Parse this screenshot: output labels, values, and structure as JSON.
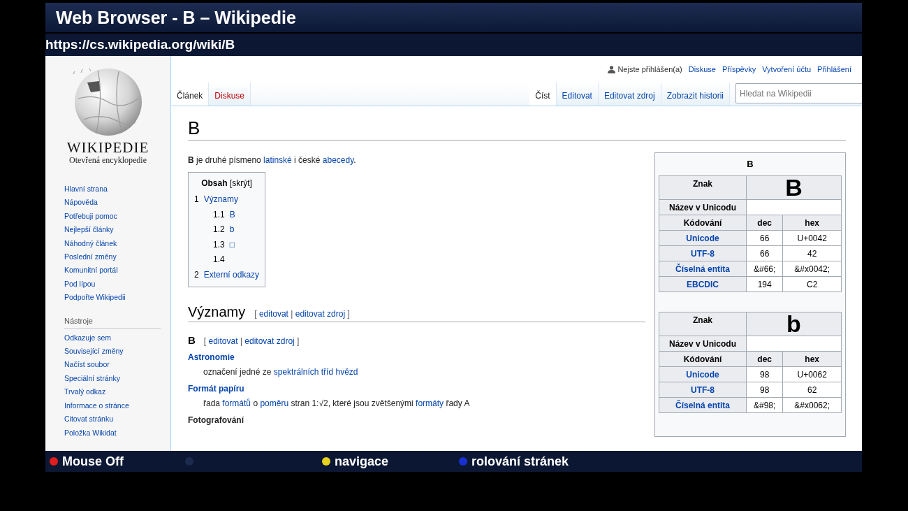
{
  "window": {
    "title": "Web Browser - B – Wikipedie"
  },
  "address_bar": {
    "url": "https://cs.wikipedia.org/wiki/B"
  },
  "page": {
    "logo": {
      "wordmark": "WIKIPEDIE",
      "tagline": "Otevřená encyklopedie"
    },
    "sidebar": {
      "navigation": [
        "Hlavní strana",
        "Nápověda",
        "Potřebuji pomoc",
        "Nejlepší články",
        "Náhodný článek",
        "Poslední změny",
        "Komunitní portál",
        "Pod lípou",
        "Podpořte Wikipedii"
      ],
      "tools_heading": "Nástroje",
      "tools": [
        "Odkazuje sem",
        "Související změny",
        "Načíst soubor",
        "Speciální stránky",
        "Trvalý odkaz",
        "Informace o stránce",
        "Citovat stránku",
        "Položka Wikidat"
      ]
    },
    "user_bar": {
      "status": "Nejste přihlášen(a)",
      "links": [
        "Diskuse",
        "Příspěvky",
        "Vytvoření účtu",
        "Přihlášení"
      ]
    },
    "tabs_left": [
      {
        "label": "Článek",
        "selected": true,
        "red_link": false
      },
      {
        "label": "Diskuse",
        "selected": false,
        "red_link": true
      }
    ],
    "tabs_right": [
      {
        "label": "Číst",
        "selected": true
      },
      {
        "label": "Editovat",
        "selected": false
      },
      {
        "label": "Editovat zdroj",
        "selected": false
      },
      {
        "label": "Zobrazit historii",
        "selected": false
      }
    ],
    "search": {
      "placeholder": "Hledat na Wikipedii"
    },
    "heading": "B",
    "intro": [
      {
        "kind": "bold",
        "text": "B"
      },
      {
        "kind": "text",
        "text": " je druhé písmeno "
      },
      {
        "kind": "link",
        "text": "latinské"
      },
      {
        "kind": "text",
        "text": " i české "
      },
      {
        "kind": "link",
        "text": "abecedy"
      },
      {
        "kind": "text",
        "text": "."
      }
    ],
    "toc": {
      "title": "Obsah",
      "toggle": "[skrýt]",
      "items": [
        {
          "number": "1",
          "label": "Významy",
          "children": [
            {
              "number": "1.1",
              "label": "B"
            },
            {
              "number": "1.2",
              "label": "b"
            },
            {
              "number": "1.3",
              "label": "□"
            },
            {
              "number": "1.4"
            }
          ]
        },
        {
          "number": "2",
          "label": "Externí odkazy"
        }
      ]
    },
    "section": {
      "title": "Významy",
      "edit_links": [
        {
          "kind": "text",
          "text": "[ "
        },
        {
          "kind": "link",
          "text": "editovat"
        },
        {
          "kind": "text",
          "text": " | "
        },
        {
          "kind": "link",
          "text": "editovat zdroj"
        },
        {
          "kind": "text",
          "text": " ]"
        }
      ]
    },
    "subsection": {
      "title": "B",
      "edit_links": [
        {
          "kind": "text",
          "text": "[ "
        },
        {
          "kind": "link",
          "text": "editovat"
        },
        {
          "kind": "text",
          "text": " | "
        },
        {
          "kind": "link",
          "text": "editovat zdroj"
        },
        {
          "kind": "text",
          "text": " ]"
        }
      ]
    },
    "definitions": [
      {
        "term": "Astronomie",
        "term_is_link": true,
        "description": [
          {
            "kind": "text",
            "text": "označení jedné ze "
          },
          {
            "kind": "link",
            "text": "spektrálních tříd hvězd"
          }
        ]
      },
      {
        "term": "Formát papíru",
        "term_is_link": true,
        "description": [
          {
            "kind": "text",
            "text": "řada "
          },
          {
            "kind": "link",
            "text": "formátů"
          },
          {
            "kind": "text",
            "text": " o "
          },
          {
            "kind": "link",
            "text": "poměru"
          },
          {
            "kind": "text",
            "text": " stran 1:√2, které jsou zvětšenými "
          },
          {
            "kind": "link",
            "text": "formáty"
          },
          {
            "kind": "text",
            "text": " řady A"
          }
        ]
      },
      {
        "term": "Fotografování",
        "term_is_link": false
      }
    ],
    "infobox": {
      "title": "B",
      "tables": [
        {
          "glyph_label": "Znak",
          "glyph": "B",
          "name_label": "Název v Unicodu",
          "columns": [
            "Kódování",
            "dec",
            "hex"
          ],
          "rows": [
            {
              "label": "Unicode",
              "dec": "66",
              "hex": "U+0042"
            },
            {
              "label": "UTF-8",
              "dec": "66",
              "hex": "42"
            },
            {
              "label": "Číselná entita",
              "dec": "&#66;",
              "hex": "&#x0042;"
            },
            {
              "label": "EBCDIC",
              "dec": "194",
              "hex": "C2"
            }
          ]
        },
        {
          "glyph_label": "Znak",
          "glyph": "b",
          "name_label": "Název v Unicodu",
          "columns": [
            "Kódování",
            "dec",
            "hex"
          ],
          "rows": [
            {
              "label": "Unicode",
              "dec": "98",
              "hex": "U+0062"
            },
            {
              "label": "UTF-8",
              "dec": "98",
              "hex": "62"
            },
            {
              "label": "Číselná entita",
              "dec": "&#98;",
              "hex": "&#x0062;"
            }
          ]
        }
      ]
    }
  },
  "bottom_bar": {
    "items": [
      {
        "label": "Mouse Off",
        "color": "#e01e1e"
      },
      {
        "color": "#1c2a4e"
      },
      {
        "label": "navigace",
        "color": "#e6d21e"
      },
      {
        "label": "rolování stránek",
        "color": "#1a2fd0"
      }
    ]
  }
}
